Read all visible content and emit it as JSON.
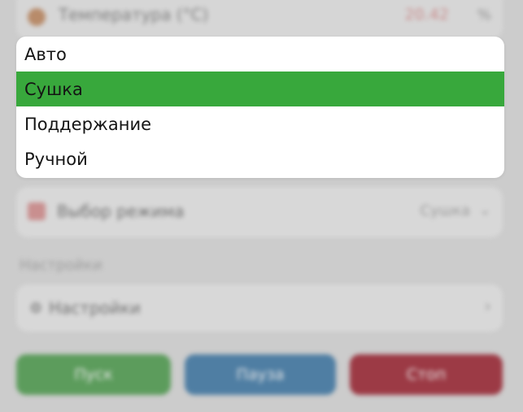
{
  "background": {
    "temperature": {
      "label": "Температура (°C)",
      "value": "20.42",
      "unit": "%",
      "icon": "thermometer-icon"
    },
    "mode_select": {
      "label": "Выбор режима",
      "value": "Сушка",
      "icon": "calendar-icon"
    },
    "section_title": "Настройки",
    "settings_row": {
      "label": "Настройки",
      "icon": "gear-icon"
    },
    "buttons": {
      "start": "Пуск",
      "pause": "Пауза",
      "stop": "Стоп"
    }
  },
  "dropdown": {
    "selected_index": 1,
    "options": [
      {
        "label": "Авто"
      },
      {
        "label": "Сушка"
      },
      {
        "label": "Поддержание"
      },
      {
        "label": "Ручной"
      }
    ]
  },
  "colors": {
    "selected": "#38a83c",
    "start": "#5c9c5c",
    "pause": "#4f7ea3",
    "stop": "#9c3a45",
    "overlay": "#cccccc"
  }
}
